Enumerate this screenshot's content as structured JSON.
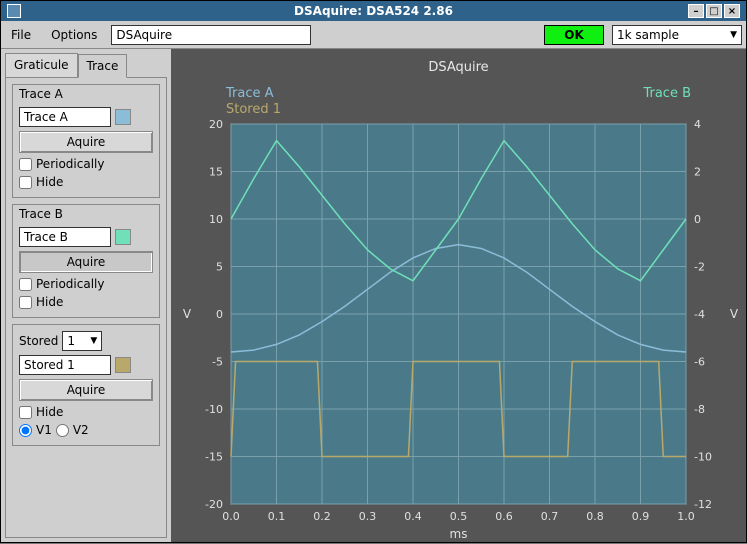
{
  "window": {
    "title": "DSAquire: DSA524 2.86"
  },
  "menu": {
    "file": "File",
    "options": "Options",
    "appname": "DSAquire",
    "ok": "OK",
    "sample": "1k sample"
  },
  "tabs": {
    "graticule": "Graticule",
    "trace": "Trace"
  },
  "traceA": {
    "title": "Trace A",
    "name": "Trace A",
    "acquire": "Aquire",
    "periodically": "Periodically",
    "hide": "Hide",
    "color": "#8bbdd8"
  },
  "traceB": {
    "title": "Trace B",
    "name": "Trace B",
    "acquire": "Aquire",
    "periodically": "Periodically",
    "hide": "Hide",
    "color": "#6fe0b8"
  },
  "stored": {
    "title": "Stored",
    "selected": "1",
    "name": "Stored 1",
    "acquire": "Aquire",
    "hide": "Hide",
    "v1": "V1",
    "v2": "V2",
    "color": "#b8a96a"
  },
  "chart_data": {
    "type": "line",
    "title": "DSAquire",
    "xlabel": "ms",
    "ylabel_left": "V",
    "ylabel_right": "V",
    "xlim": [
      0.0,
      1.0
    ],
    "x_ticks": [
      0.0,
      0.1,
      0.2,
      0.3,
      0.4,
      0.5,
      0.6,
      0.7,
      0.8,
      0.9,
      1.0
    ],
    "ylim_left": [
      -20,
      20
    ],
    "y_left_ticks": [
      -20,
      -15,
      -10,
      -5,
      0,
      5,
      10,
      15,
      20
    ],
    "ylim_right": [
      -12,
      4
    ],
    "y_right_ticks": [
      -12,
      -10,
      -8,
      -6,
      -4,
      -2,
      0,
      2,
      4
    ],
    "legend": {
      "TraceA_label": "Trace A",
      "Stored_label": "Stored 1",
      "TraceB_label": "Trace B"
    },
    "series": [
      {
        "name": "Trace A",
        "axis": "left",
        "color": "#8bbdd8",
        "x": [
          0.0,
          0.05,
          0.1,
          0.15,
          0.2,
          0.25,
          0.3,
          0.35,
          0.4,
          0.45,
          0.5,
          0.55,
          0.6,
          0.65,
          0.7,
          0.75,
          0.8,
          0.85,
          0.9,
          0.95,
          1.0
        ],
        "y": [
          -4.0,
          -3.8,
          -3.2,
          -2.2,
          -0.8,
          0.8,
          2.6,
          4.4,
          5.9,
          6.9,
          7.3,
          6.9,
          5.9,
          4.4,
          2.6,
          0.8,
          -0.8,
          -2.2,
          -3.2,
          -3.8,
          -4.0
        ]
      },
      {
        "name": "Trace B",
        "axis": "right",
        "color": "#6fe0b8",
        "x": [
          0.0,
          0.05,
          0.1,
          0.15,
          0.2,
          0.25,
          0.3,
          0.35,
          0.4,
          0.45,
          0.5,
          0.55,
          0.6,
          0.65,
          0.7,
          0.75,
          0.8,
          0.85,
          0.9,
          0.95,
          1.0
        ],
        "y": [
          0.0,
          1.7,
          3.3,
          2.2,
          1.0,
          -0.2,
          -1.3,
          -2.1,
          -2.6,
          -1.3,
          0.0,
          1.7,
          3.3,
          2.2,
          1.0,
          -0.2,
          -1.3,
          -2.1,
          -2.6,
          -1.3,
          0.0
        ]
      },
      {
        "name": "Stored 1",
        "axis": "right",
        "color": "#b8a96a",
        "x": [
          0.0,
          0.01,
          0.19,
          0.2,
          0.39,
          0.4,
          0.59,
          0.6,
          0.74,
          0.75,
          0.94,
          0.95,
          1.0
        ],
        "y": [
          -10,
          -6,
          -6,
          -10,
          -10,
          -6,
          -6,
          -10,
          -10,
          -6,
          -6,
          -10,
          -10
        ]
      }
    ]
  }
}
